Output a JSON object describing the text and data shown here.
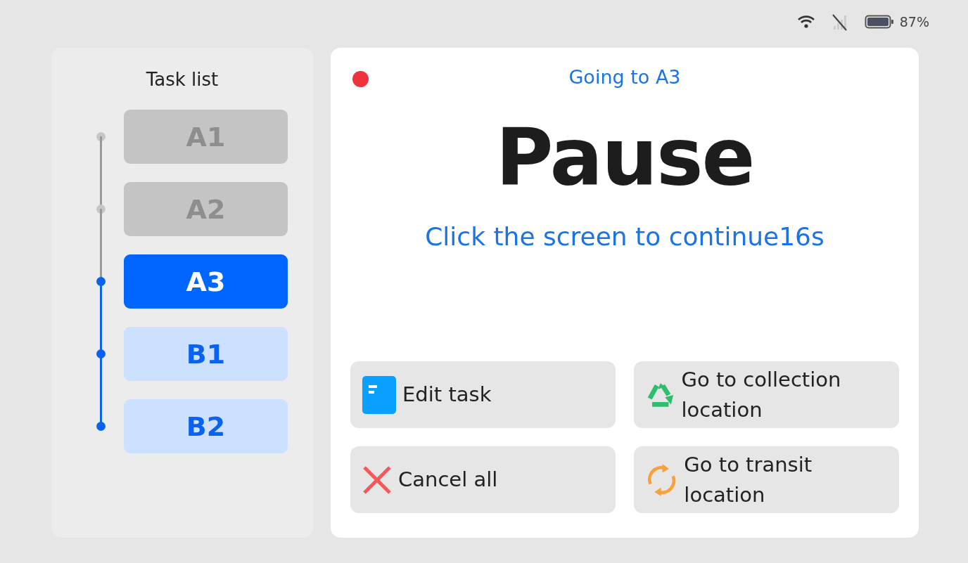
{
  "status_bar": {
    "battery": "87%"
  },
  "task_list": {
    "title": "Task list",
    "items": [
      {
        "label": "A1",
        "kind": "done",
        "selected": false
      },
      {
        "label": "A2",
        "kind": "done",
        "selected": false
      },
      {
        "label": "A3",
        "kind": "pending",
        "selected": true
      },
      {
        "label": "B1",
        "kind": "pending",
        "selected": false
      },
      {
        "label": "B2",
        "kind": "pending",
        "selected": false
      }
    ]
  },
  "main": {
    "recording": true,
    "heading": "Going to A3",
    "title": "Pause",
    "prompt": "Click the screen to continue16s",
    "actions": [
      {
        "label": "Edit task",
        "kind": "edit"
      },
      {
        "label": "Go to collection location",
        "kind": "collect"
      },
      {
        "label": "Cancel all",
        "kind": "cancel"
      },
      {
        "label": "Go to transit location",
        "kind": "transit"
      }
    ]
  }
}
